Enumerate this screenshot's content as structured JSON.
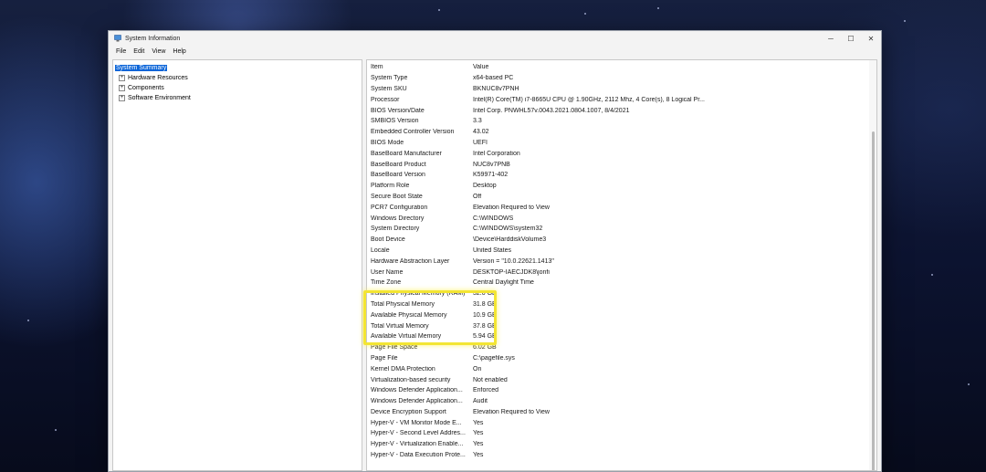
{
  "window": {
    "title": "System Information",
    "controls": {
      "minimize": "─",
      "maximize": "☐",
      "close": "✕"
    }
  },
  "menu": [
    "File",
    "Edit",
    "View",
    "Help"
  ],
  "tree": {
    "selected": "System Summary",
    "children": [
      "Hardware Resources",
      "Components",
      "Software Environment"
    ]
  },
  "table": {
    "headers": {
      "item": "Item",
      "value": "Value"
    },
    "rows": [
      {
        "item": "System Type",
        "value": "x64-based PC"
      },
      {
        "item": "System SKU",
        "value": "BKNUC8v7PNH"
      },
      {
        "item": "Processor",
        "value": "Intel(R) Core(TM) i7-8665U CPU @ 1.90GHz, 2112 Mhz, 4 Core(s), 8 Logical Pr..."
      },
      {
        "item": "BIOS Version/Date",
        "value": "Intel Corp. PNWHL57v.0043.2021.0804.1007, 8/4/2021"
      },
      {
        "item": "SMBIOS Version",
        "value": "3.3"
      },
      {
        "item": "Embedded Controller Version",
        "value": "43.02"
      },
      {
        "item": "BIOS Mode",
        "value": "UEFI"
      },
      {
        "item": "BaseBoard Manufacturer",
        "value": "Intel Corporation"
      },
      {
        "item": "BaseBoard Product",
        "value": "NUC8v7PNB"
      },
      {
        "item": "BaseBoard Version",
        "value": "K59971-402"
      },
      {
        "item": "Platform Role",
        "value": "Desktop"
      },
      {
        "item": "Secure Boot State",
        "value": "Off"
      },
      {
        "item": "PCR7 Configuration",
        "value": "Elevation Required to View"
      },
      {
        "item": "Windows Directory",
        "value": "C:\\WINDOWS"
      },
      {
        "item": "System Directory",
        "value": "C:\\WINDOWS\\system32"
      },
      {
        "item": "Boot Device",
        "value": "\\Device\\HarddiskVolume3"
      },
      {
        "item": "Locale",
        "value": "United States"
      },
      {
        "item": "Hardware Abstraction Layer",
        "value": "Version = \"10.0.22621.1413\""
      },
      {
        "item": "User Name",
        "value": "DESKTOP-IAECJDK8\\jonfi"
      },
      {
        "item": "Time Zone",
        "value": "Central Daylight Time"
      },
      {
        "item": "Installed Physical Memory (RAM)",
        "value": "32.0 GB"
      },
      {
        "item": "Total Physical Memory",
        "value": "31.8 GB"
      },
      {
        "item": "Available Physical Memory",
        "value": "10.9 GB"
      },
      {
        "item": "Total Virtual Memory",
        "value": "37.8 GB"
      },
      {
        "item": "Available Virtual Memory",
        "value": "5.94 GB"
      },
      {
        "item": "Page File Space",
        "value": "6.02 GB"
      },
      {
        "item": "Page File",
        "value": "C:\\pagefile.sys"
      },
      {
        "item": "Kernel DMA Protection",
        "value": "On"
      },
      {
        "item": "Virtualization-based security",
        "value": "Not enabled"
      },
      {
        "item": "Windows Defender Application...",
        "value": "Enforced"
      },
      {
        "item": "Windows Defender Application...",
        "value": "Audit"
      },
      {
        "item": "Device Encryption Support",
        "value": "Elevation Required to View"
      },
      {
        "item": "Hyper-V - VM Monitor Mode E...",
        "value": "Yes"
      },
      {
        "item": "Hyper-V - Second Level Addres...",
        "value": "Yes"
      },
      {
        "item": "Hyper-V - Virtualization Enable...",
        "value": "Yes"
      },
      {
        "item": "Hyper-V - Data Execution Prote...",
        "value": "Yes"
      }
    ]
  },
  "colors": {
    "selection": "#0a64d8",
    "highlight": "#f3e533"
  }
}
